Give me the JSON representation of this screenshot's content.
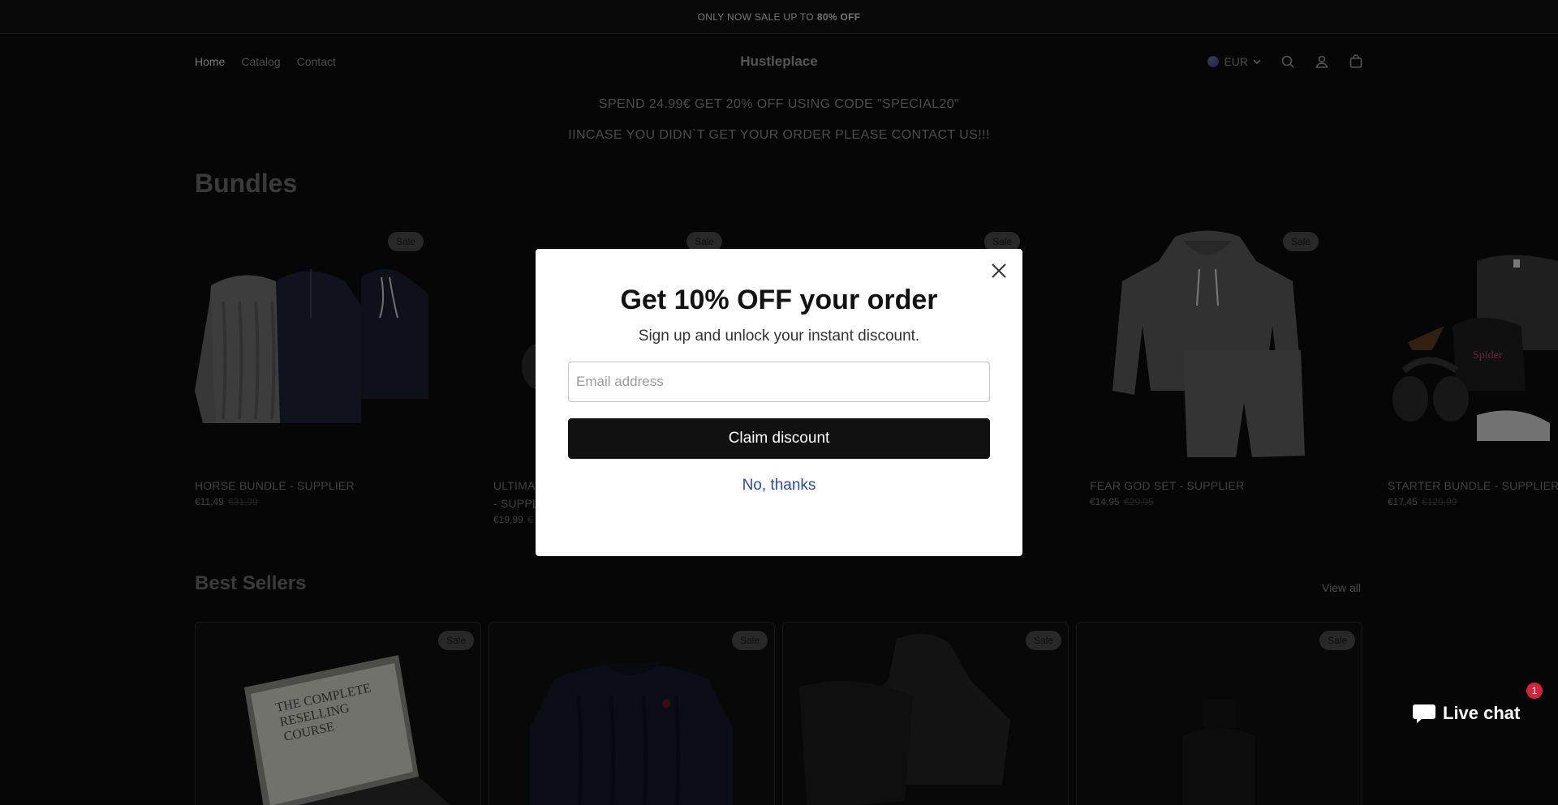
{
  "announcement": {
    "text": "ONLY NOW SALE UP TO",
    "highlight": "80% OFF"
  },
  "header": {
    "nav": [
      "Home",
      "Catalog",
      "Contact"
    ],
    "brand": "Hustleplace",
    "currency": "EUR"
  },
  "promo": {
    "line1": "SPEND 24.99€ GET 20% OFF USING CODE \"SPECIAL20\"",
    "line2": "IINCASE YOU DIDN`T GET YOUR ORDER PLEASE CONTACT US!!!"
  },
  "bundles": {
    "title": "Bundles",
    "items": [
      {
        "name": "HORSE BUNDLE - SUPPLIER",
        "price": "€11,49",
        "compare": "€31,99",
        "badge": "Sale"
      },
      {
        "name": "ULTIMA",
        "name2": "- SUPPL",
        "price": "€19,99",
        "compare": "€",
        "badge": "Sale"
      },
      {
        "name": "",
        "price": "",
        "compare": "",
        "badge": "Sale"
      },
      {
        "name": "FEAR GOD SET - SUPPLIER",
        "price": "€14,95",
        "compare": "€29,95",
        "badge": "Sale"
      },
      {
        "name": "STARTER BUNDLE - SUPPLIER",
        "price": "€17,45",
        "compare": "€129,99",
        "badge": "Sale"
      }
    ]
  },
  "best_sellers": {
    "title": "Best Sellers",
    "view_all": "View all",
    "badge": "Sale"
  },
  "modal": {
    "title": "Get 10% OFF your order",
    "subtitle": "Sign up and unlock your instant discount.",
    "email_placeholder": "Email address",
    "claim_label": "Claim discount",
    "decline_label": "No, thanks"
  },
  "livechat": {
    "label": "Live chat",
    "count": "1"
  }
}
